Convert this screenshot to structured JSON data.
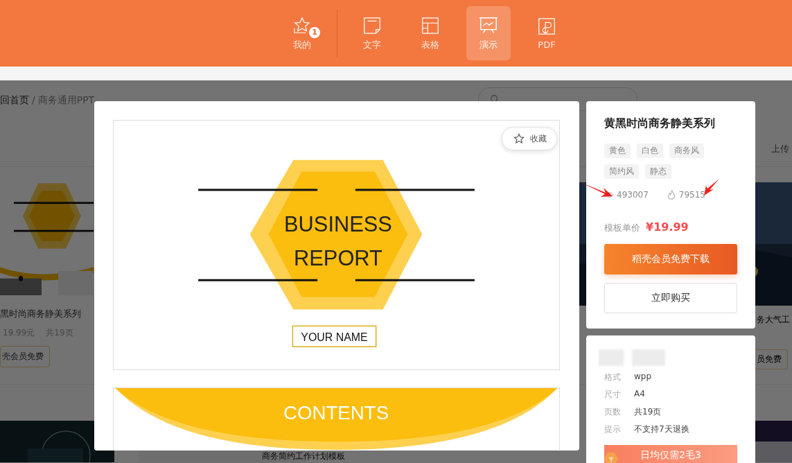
{
  "nav": {
    "items": [
      {
        "label": "我的",
        "kind": "star",
        "badge": "1",
        "selected": false
      },
      {
        "label": "文字",
        "kind": "doc",
        "selected": false
      },
      {
        "label": "表格",
        "kind": "table",
        "selected": false
      },
      {
        "label": "演示",
        "kind": "slides",
        "selected": true
      },
      {
        "label": "PDF",
        "kind": "pdf",
        "selected": false
      }
    ]
  },
  "background": {
    "breadcrumb": {
      "home": "回首页",
      "separator": "/",
      "current": "商务通用PPT"
    },
    "upload": "上传",
    "left_card": {
      "title": "黑时尚商务静美系列",
      "price": "19.99元",
      "pages": "共19页",
      "button": "壳会员免费"
    },
    "right_card": {
      "title": "务大气工",
      "button": "员免费"
    },
    "bottom_card": {
      "title": "商务简约工作计划模板"
    }
  },
  "preview": {
    "favorite": "收藏",
    "slides": [
      {
        "kind": "cover",
        "title_lines": [
          "BUSINESS",
          "REPORT"
        ],
        "subtitle": "YOUR   NAME"
      },
      {
        "kind": "contents",
        "heading": "CONTENTS"
      }
    ]
  },
  "info": {
    "title": "黄黑时尚商务静美系列",
    "tags": [
      "黄色",
      "白色",
      "商务风",
      "简约风",
      "静态"
    ],
    "views": "493007",
    "likes": "79515",
    "price_label": "模板单价",
    "price": "¥19.99",
    "primary_button": "稻壳会员免费下载",
    "secondary_button": "立即购买"
  },
  "specs": {
    "rows": [
      {
        "label": "格式",
        "value": "wpp"
      },
      {
        "label": "尺寸",
        "value": "A4"
      },
      {
        "label": "页数",
        "value": "共19页"
      },
      {
        "label": "提示",
        "value": "不支持7天退换"
      }
    ],
    "promo": "日均仅需2毛3"
  }
}
